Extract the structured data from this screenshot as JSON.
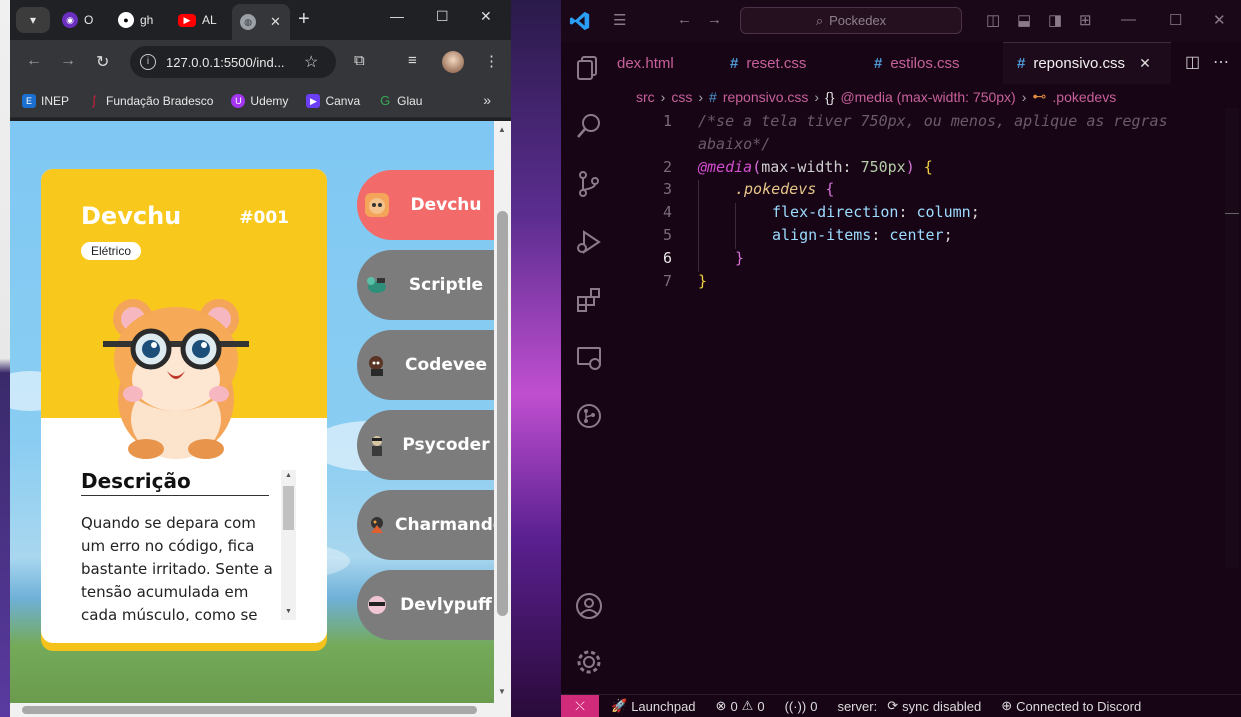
{
  "browser": {
    "tabs": [
      {
        "label": "O",
        "icon": "github-copilot-icon",
        "color": "#8b3fd9"
      },
      {
        "label": "gh",
        "icon": "github-icon",
        "color": "#ffffff"
      },
      {
        "label": "AL",
        "icon": "youtube-icon",
        "color": "#ff0000"
      },
      {
        "label": "",
        "icon": "globe-icon",
        "color": "#9aa0a6",
        "active": true
      }
    ],
    "url": "127.0.0.1:5500/ind...",
    "bookmarks": [
      {
        "label": "INEP",
        "color": "#1a6fd1",
        "glyph": "E"
      },
      {
        "label": "Fundação Bradesco",
        "color": "#cc1f3a",
        "glyph": "ʃ"
      },
      {
        "label": "Udemy",
        "color": "#a435f0",
        "glyph": "U"
      },
      {
        "label": "Canva",
        "color": "#6b3df5",
        "glyph": "▶"
      },
      {
        "label": "Glau",
        "color": "#34a853",
        "glyph": "G"
      }
    ]
  },
  "pokedex": {
    "card": {
      "name": "Devchu",
      "id": "#001",
      "type": "Elétrico",
      "description_title": "Descrição",
      "description": "Quando se depara com um erro no código, fica bastante irritado. Sente a tensão acumulada em cada músculo, como se"
    },
    "devs": [
      {
        "name": "Devchu",
        "bg": "#f26a6a",
        "icon": "hamster-icon"
      },
      {
        "name": "Scriptle",
        "bg": "#7c7c7c",
        "icon": "turtle-icon"
      },
      {
        "name": "Codevee",
        "bg": "#7c7c7c",
        "icon": "fox-icon"
      },
      {
        "name": "Psycoder",
        "bg": "#7c7c7c",
        "icon": "duck-icon"
      },
      {
        "name": "Charmandev",
        "bg": "#7c7c7c",
        "icon": "dragon-icon"
      },
      {
        "name": "Devlypuff",
        "bg": "#7c7c7c",
        "icon": "puff-icon"
      }
    ]
  },
  "vscode": {
    "search": "Pockedex",
    "tabs": [
      {
        "label": "dex.html",
        "type": "html"
      },
      {
        "label": "reset.css",
        "type": "css"
      },
      {
        "label": "estilos.css",
        "type": "css"
      },
      {
        "label": "reponsivo.css",
        "type": "css",
        "active": true
      }
    ],
    "breadcrumb": {
      "folder1": "src",
      "folder2": "css",
      "file": "reponsivo.css",
      "media": "@media (max-width: 750px)",
      "selector": ".pokedevs"
    },
    "code": {
      "comment_line1": "/*se a tela tiver 750px, ou menos, aplique as regras",
      "comment_line2": "abaixo*/",
      "media_kw": "@media",
      "media_prop": "max-width",
      "media_val": "750px",
      "selector": ".pokedevs",
      "prop1": "flex-direction",
      "val1": "column",
      "prop2": "align-items",
      "val2": "center"
    },
    "line_numbers": [
      "1",
      "2",
      "3",
      "4",
      "5",
      "6",
      "7"
    ],
    "status": {
      "launchpad": "Launchpad",
      "errors": "0",
      "warnings": "0",
      "ports": "0",
      "server": "server:",
      "sync": "sync",
      "sync_state": "disabled",
      "discord": "Connected to Discord"
    }
  }
}
